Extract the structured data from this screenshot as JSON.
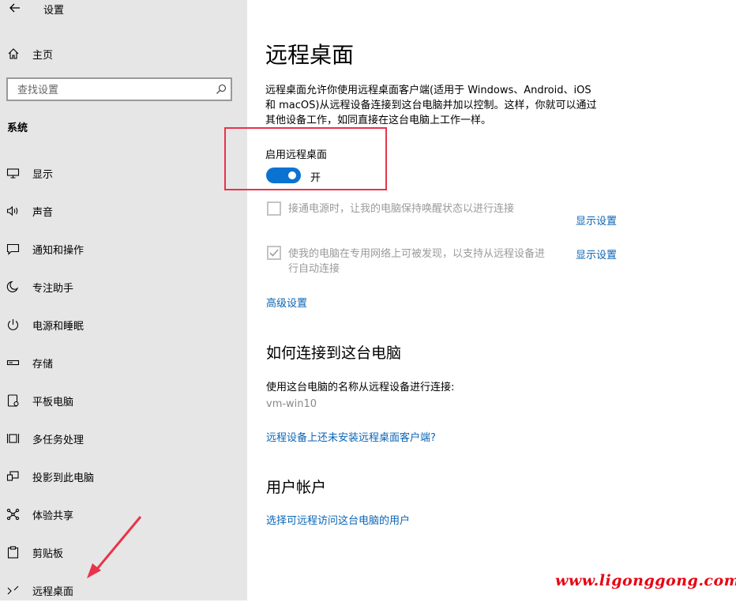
{
  "window": {
    "title": "设置"
  },
  "sidebar": {
    "home_label": "主页",
    "search_placeholder": "查找设置",
    "section_title": "系统",
    "items": [
      {
        "label": "显示",
        "icon": "display-icon"
      },
      {
        "label": "声音",
        "icon": "speaker-icon"
      },
      {
        "label": "通知和操作",
        "icon": "notification-icon"
      },
      {
        "label": "专注助手",
        "icon": "moon-icon"
      },
      {
        "label": "电源和睡眠",
        "icon": "power-icon"
      },
      {
        "label": "存储",
        "icon": "storage-icon"
      },
      {
        "label": "平板电脑",
        "icon": "tablet-icon"
      },
      {
        "label": "多任务处理",
        "icon": "multitasking-icon"
      },
      {
        "label": "投影到此电脑",
        "icon": "projecting-icon"
      },
      {
        "label": "体验共享",
        "icon": "shared-experiences-icon"
      },
      {
        "label": "剪贴板",
        "icon": "clipboard-icon"
      },
      {
        "label": "远程桌面",
        "icon": "remote-desktop-icon"
      }
    ]
  },
  "main": {
    "title": "远程桌面",
    "description_line1": "远程桌面允许你使用远程桌面客户端(适用于 Windows、Android、iOS",
    "description_line2": "和 macOS)从远程设备连接到这台电脑并加以控制。这样，你就可以通过",
    "description_line3": "其他设备工作，如同直接在这台电脑上工作一样。",
    "enable_label": "启用远程桌面",
    "toggle_state": "开",
    "toggle_on": true,
    "option1": {
      "text": "接通电源时，让我的电脑保持唤醒状态以进行连接",
      "checked": false,
      "link": "显示设置"
    },
    "option2": {
      "text_line1": "使我的电脑在专用网络上可被发现，以支持从远程设备进",
      "text_line2": "行自动连接",
      "checked": true,
      "link": "显示设置"
    },
    "advanced_link": "高级设置",
    "connect_heading": "如何连接到这台电脑",
    "connect_text": "使用这台电脑的名称从远程设备进行连接:",
    "pc_name": "vm-win10",
    "client_link": "远程设备上还未安装远程桌面客户端?",
    "accounts_heading": "用户帐户",
    "accounts_link": "选择可远程访问这台电脑的用户"
  },
  "watermark": "www.ligonggong.com",
  "colors": {
    "accent": "#0a73d1",
    "link": "#0a64b4",
    "highlight": "#e8334a",
    "watermark": "#e60012",
    "sidebar_bg": "#e6e6e6"
  }
}
